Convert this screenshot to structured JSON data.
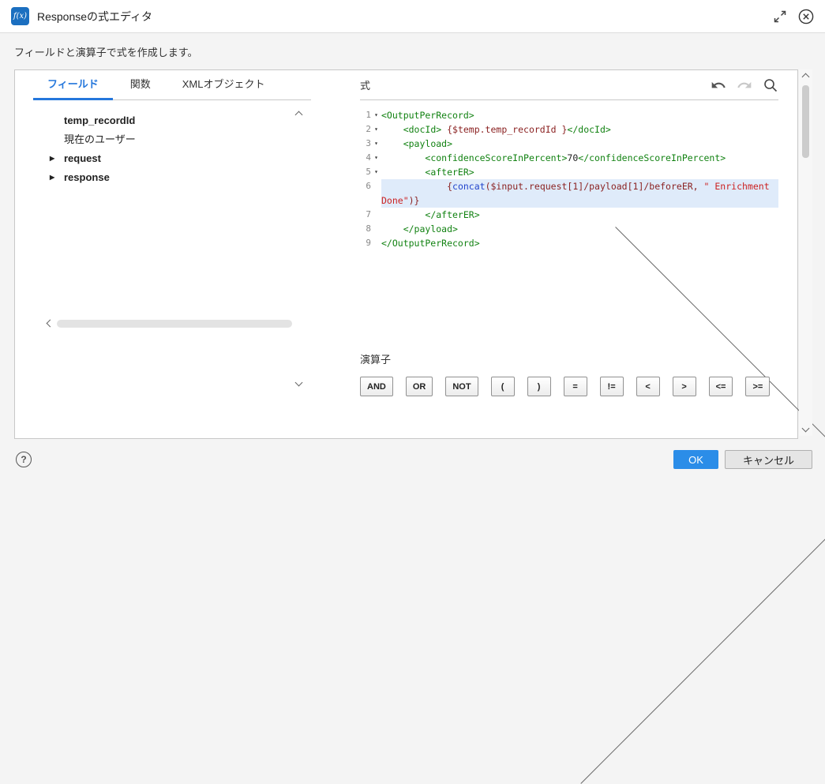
{
  "colors": {
    "accent": "#2577dc",
    "ok_button": "#2b8de8",
    "line_highlight": "#dfebfa",
    "tag": "#128212",
    "expr": "#8b2222",
    "func": "#2244cc",
    "string": "#cc2222",
    "plain": "#222222"
  },
  "icons": {
    "header": [
      "fx-icon",
      "maximize-icon",
      "close-icon"
    ],
    "expression": [
      "undo-icon",
      "redo-icon",
      "search-icon"
    ],
    "footer": [
      "help-icon"
    ]
  },
  "header": {
    "icon": "f(x)",
    "title": "Responseの式エディタ"
  },
  "subtitle": "フィールドと演算子で式を作成します。",
  "fields_panel": {
    "tabs": [
      {
        "label": "フィールド",
        "active": true
      },
      {
        "label": "関数",
        "active": false
      },
      {
        "label": "XMLオブジェクト",
        "active": false
      }
    ],
    "items": [
      {
        "label": "temp_recordId",
        "bold": true,
        "expandable": false
      },
      {
        "label": "現在のユーザー",
        "bold": false,
        "expandable": false
      },
      {
        "label": "request",
        "bold": true,
        "expandable": true
      },
      {
        "label": "response",
        "bold": true,
        "expandable": true
      }
    ]
  },
  "expression_editor": {
    "label": "式",
    "lines": [
      {
        "num": "1",
        "fold": true,
        "highlight": false,
        "segments": [
          {
            "t": "<OutputPerRecord>",
            "c": "tag"
          }
        ]
      },
      {
        "num": "2",
        "fold": true,
        "highlight": false,
        "segments": [
          {
            "t": "    <docId> ",
            "c": "tag"
          },
          {
            "t": "{$temp.temp_recordId }",
            "c": "expr"
          },
          {
            "t": "</docId>",
            "c": "tag"
          }
        ]
      },
      {
        "num": "3",
        "fold": true,
        "highlight": false,
        "segments": [
          {
            "t": "    <payload>",
            "c": "tag"
          }
        ]
      },
      {
        "num": "4",
        "fold": true,
        "highlight": false,
        "segments": [
          {
            "t": "        <confidenceScoreInPercent>",
            "c": "tag"
          },
          {
            "t": "70",
            "c": "plain"
          },
          {
            "t": "</confidenceScoreInPercent>",
            "c": "tag"
          }
        ]
      },
      {
        "num": "5",
        "fold": true,
        "highlight": false,
        "segments": [
          {
            "t": "        <afterER>",
            "c": "tag"
          }
        ]
      },
      {
        "num": "6",
        "fold": false,
        "highlight": true,
        "segments": [
          {
            "t": "            {",
            "c": "expr"
          },
          {
            "t": "concat",
            "c": "func"
          },
          {
            "t": "($input.request[1]/payload[1]/beforeER, ",
            "c": "expr"
          },
          {
            "t": "\" Enrichment Done\"",
            "c": "string"
          },
          {
            "t": ")}",
            "c": "expr"
          }
        ]
      },
      {
        "num": "7",
        "fold": false,
        "highlight": false,
        "segments": [
          {
            "t": "        </afterER>",
            "c": "tag"
          }
        ]
      },
      {
        "num": "8",
        "fold": false,
        "highlight": false,
        "segments": [
          {
            "t": "    </payload>",
            "c": "tag"
          }
        ]
      },
      {
        "num": "9",
        "fold": false,
        "highlight": false,
        "segments": [
          {
            "t": "</OutputPerRecord>",
            "c": "tag"
          }
        ]
      }
    ]
  },
  "operators": {
    "label": "演算子",
    "buttons": [
      "AND",
      "OR",
      "NOT",
      "(",
      ")",
      "=",
      "!=",
      "<",
      ">",
      "<=",
      ">="
    ]
  },
  "footer": {
    "help_icon": "?",
    "ok_label": "OK",
    "cancel_label": "キャンセル"
  }
}
